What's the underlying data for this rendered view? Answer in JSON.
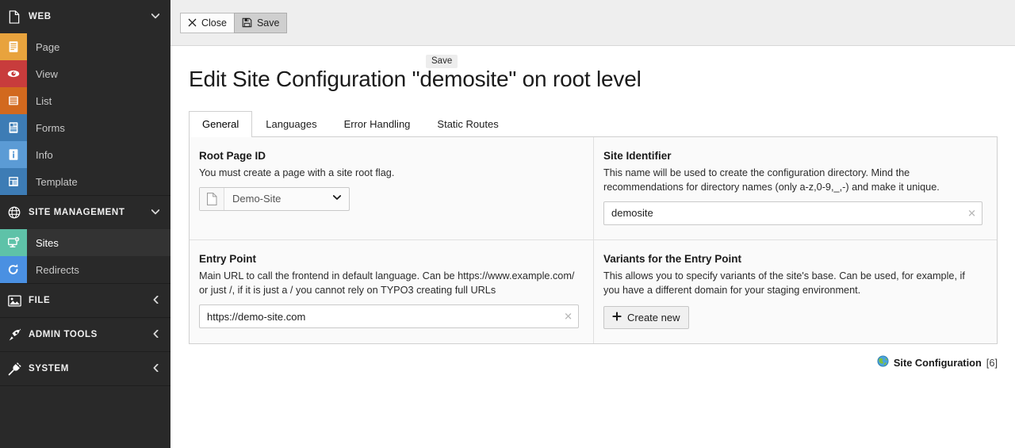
{
  "sidebar": {
    "sections": [
      {
        "key": "web",
        "label": "WEB",
        "icon": "page-doc-icon",
        "caret": "chevron-down-icon",
        "expanded": true,
        "items": [
          {
            "label": "Page",
            "icon": "page-module-icon",
            "color": "#e8a33d",
            "active": false
          },
          {
            "label": "View",
            "icon": "view-eye-icon",
            "color": "#c83c3c",
            "active": false
          },
          {
            "label": "List",
            "icon": "list-module-icon",
            "color": "#d2691e",
            "active": false
          },
          {
            "label": "Forms",
            "icon": "forms-module-icon",
            "color": "#3d7cb5",
            "active": false
          },
          {
            "label": "Info",
            "icon": "info-module-icon",
            "color": "#5b9bd5",
            "active": false
          },
          {
            "label": "Template",
            "icon": "template-module-icon",
            "color": "#3d7cb5",
            "active": false
          }
        ]
      },
      {
        "key": "site-management",
        "label": "SITE MANAGEMENT",
        "icon": "globe-icon",
        "caret": "chevron-down-icon",
        "expanded": true,
        "items": [
          {
            "label": "Sites",
            "icon": "sites-monitor-gear-icon",
            "color": "#5ec2a8",
            "active": true
          },
          {
            "label": "Redirects",
            "icon": "redirect-refresh-icon",
            "color": "#4a90e2",
            "active": false
          }
        ]
      },
      {
        "key": "file",
        "label": "FILE",
        "icon": "image-icon",
        "caret": "chevron-left-icon",
        "expanded": false,
        "items": []
      },
      {
        "key": "admin-tools",
        "label": "ADMIN TOOLS",
        "icon": "rocket-icon",
        "caret": "chevron-left-icon",
        "expanded": false,
        "items": []
      },
      {
        "key": "system",
        "label": "SYSTEM",
        "icon": "plug-icon",
        "caret": "chevron-left-icon",
        "expanded": false,
        "items": []
      }
    ]
  },
  "toolbar": {
    "close_label": "Close",
    "close_icon": "close-x-icon",
    "save_label": "Save",
    "save_icon": "floppy-disk-icon",
    "tooltip": "Save"
  },
  "page": {
    "title": "Edit Site Configuration \"demosite\" on root level"
  },
  "tabs": [
    {
      "label": "General",
      "active": true
    },
    {
      "label": "Languages",
      "active": false
    },
    {
      "label": "Error Handling",
      "active": false
    },
    {
      "label": "Static Routes",
      "active": false
    }
  ],
  "fields": {
    "root_page_id": {
      "label": "Root Page ID",
      "description": "You must create a page with a site root flag.",
      "selected": "Demo-Site",
      "addon_icon": "page-doc-icon",
      "caret_icon": "chevron-down-icon"
    },
    "site_identifier": {
      "label": "Site Identifier",
      "description": "This name will be used to create the configuration directory. Mind the recommendations for directory names (only a-z,0-9,_,-) and make it unique.",
      "value": "demosite",
      "clear_icon": "clear-x-icon"
    },
    "entry_point": {
      "label": "Entry Point",
      "description": "Main URL to call the frontend in default language. Can be https://www.example.com/ or just /, if it is just a / you cannot rely on TYPO3 creating full URLs",
      "value": "https://demo-site.com",
      "clear_icon": "clear-x-icon"
    },
    "variants": {
      "label": "Variants for the Entry Point",
      "description": "This allows you to specify variants of the site's base. Can be used, for example, if you have a different domain for your staging environment.",
      "create_label": "Create new",
      "create_icon": "plus-icon"
    }
  },
  "footer": {
    "icon": "globe-earth-icon",
    "record_type": "Site Configuration",
    "record_count": "[6]"
  },
  "colors": {
    "sidebar_bg": "#292929",
    "sidebar_active": "#333333",
    "toolbar_bg": "#eeeeee",
    "panel_bg": "#fafafa",
    "border": "#d0d0d0",
    "accent_sites": "#5ec2a8",
    "accent_redirects": "#4a90e2"
  }
}
